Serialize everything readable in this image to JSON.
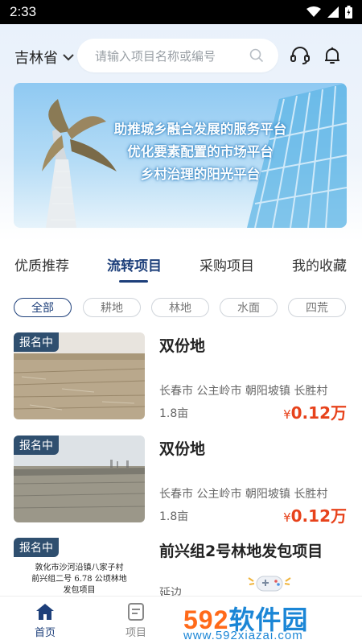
{
  "status_bar": {
    "time": "2:33"
  },
  "header": {
    "province": "吉林省",
    "search_placeholder": "请输入项目名称或编号"
  },
  "banner": {
    "lines": [
      "助推城乡融合发展的服务平台",
      "优化要素配置的市场平台",
      "乡村治理的阳光平台"
    ]
  },
  "tabs": [
    {
      "label": "优质推荐"
    },
    {
      "label": "流转项目",
      "active": true
    },
    {
      "label": "采购项目"
    },
    {
      "label": "我的收藏"
    }
  ],
  "filters": [
    {
      "label": "全部",
      "active": true
    },
    {
      "label": "耕地"
    },
    {
      "label": "林地"
    },
    {
      "label": "水面"
    },
    {
      "label": "四荒"
    }
  ],
  "listings": [
    {
      "badge": "报名中",
      "title": "双份地",
      "location": "长春市 公主岭市 朝阳坡镇 长胜村",
      "area": "1.8亩",
      "price_symbol": "¥",
      "price": "0.12万"
    },
    {
      "badge": "报名中",
      "title": "双份地",
      "location": "长春市 公主岭市 朝阳坡镇 长胜村",
      "area": "1.8亩",
      "price_symbol": "¥",
      "price": "0.12万"
    },
    {
      "badge": "报名中",
      "title": "前兴组2号林地发包项目",
      "location": "延边",
      "thumb_text": [
        "敦化市沙河沿镇八家子村",
        "前兴组二号 6.78 公顷林地",
        "发包项目"
      ]
    }
  ],
  "bottom_nav": [
    {
      "label": "首页",
      "icon": "home-icon",
      "active": true
    },
    {
      "label": "项目",
      "icon": "document-icon"
    }
  ],
  "watermark": {
    "brand_num": "592",
    "brand_cn": "软件园",
    "url": "www.592xiazai.com"
  },
  "colors": {
    "accent": "#1d3f7a",
    "price": "#e7421b",
    "badge": "#2f4f6f"
  }
}
